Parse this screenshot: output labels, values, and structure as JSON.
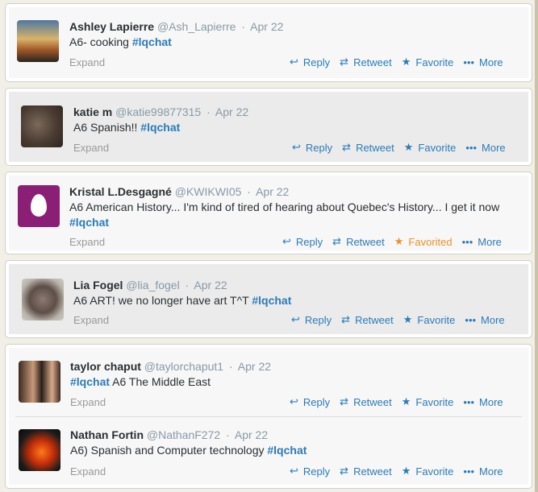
{
  "actions": {
    "reply": "Reply",
    "retweet": "Retweet",
    "favorite": "Favorite",
    "favorited": "Favorited",
    "more": "More",
    "expand": "Expand"
  },
  "tweets": [
    {
      "name": "Ashley Lapierre",
      "handle": "@Ash_Lapierre",
      "date": "Apr 22",
      "text_before": "A6- cooking ",
      "hashtag": "#lqchat",
      "text_after": ""
    },
    {
      "name": "katie m",
      "handle": "@katie99877315",
      "date": "Apr 22",
      "text_before": "A6 Spanish!! ",
      "hashtag": "#lqchat",
      "text_after": ""
    },
    {
      "name": "Kristal L.Desgagné",
      "handle": "@KWIKWI05",
      "date": "Apr 22",
      "text_before": "A6 American History... I'm kind of tired of hearing about Quebec's History... I get it now ",
      "hashtag": "#lqchat",
      "text_after": ""
    },
    {
      "name": "Lia Fogel",
      "handle": "@lia_fogel",
      "date": "Apr 22",
      "text_before": "A6 ART! we no longer have art T^T ",
      "hashtag": "#lqchat",
      "text_after": ""
    },
    {
      "name": "taylor chaput",
      "handle": "@taylorchaput1",
      "date": "Apr 22",
      "text_before": "",
      "hashtag": "#lqchat",
      "text_after": " A6 The Middle East"
    },
    {
      "name": "Nathan Fortin",
      "handle": "@NathanF272",
      "date": "Apr 22",
      "text_before": "A6) Spanish and Computer technology ",
      "hashtag": "#lqchat",
      "text_after": ""
    }
  ],
  "colors": {
    "link": "#2b7bb9",
    "favorited": "#e79427",
    "muted": "#8899a6"
  },
  "icons": {
    "reply": "reply-arrow-icon",
    "retweet": "retweet-icon",
    "favorite": "star-icon",
    "more": "ellipsis-icon"
  }
}
